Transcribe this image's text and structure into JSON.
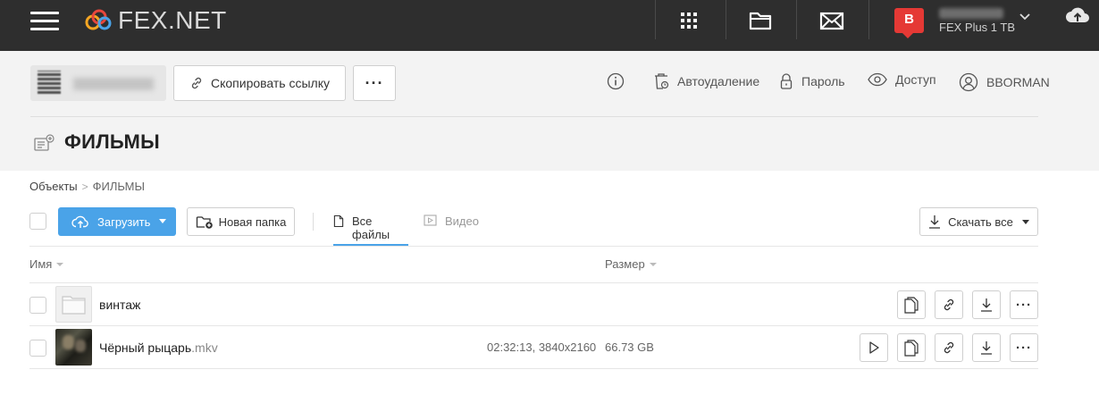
{
  "header": {
    "logo_text": "FEX.NET",
    "avatar_letter": "B",
    "account_plan": "FEX Plus 1 TB",
    "icons": [
      "menu-icon",
      "apps-grid-icon",
      "folder-open-icon",
      "mail-icon",
      "cloud-upload-icon"
    ]
  },
  "share": {
    "copy_link_label": "Скопировать ссылку",
    "more_label": "···",
    "actions": {
      "autodelete": "Автоудаление",
      "password": "Пароль",
      "access": "Доступ",
      "user": "BBORMAN"
    }
  },
  "page": {
    "title": "ФИЛЬМЫ"
  },
  "breadcrumb": {
    "root": "Объекты",
    "separator": ">",
    "current": "ФИЛЬМЫ"
  },
  "toolbar": {
    "upload_label": "Загрузить",
    "new_folder_label": "Новая папка",
    "tab_all": "Все файлы",
    "tab_video": "Видео",
    "download_all_label": "Скачать все"
  },
  "table": {
    "col_name": "Имя",
    "col_size": "Размер",
    "rows": [
      {
        "name": "винтаж",
        "ext": "",
        "meta": "",
        "size": "",
        "type": "folder"
      },
      {
        "name": "Чёрный рыцарь",
        "ext": ".mkv",
        "meta": "02:32:13, 3840x2160",
        "size": "66.73 GB",
        "type": "video"
      }
    ]
  },
  "colors": {
    "topbar": "#2e2e2e",
    "accent": "#4aa3e8",
    "avatar": "#e53935"
  }
}
